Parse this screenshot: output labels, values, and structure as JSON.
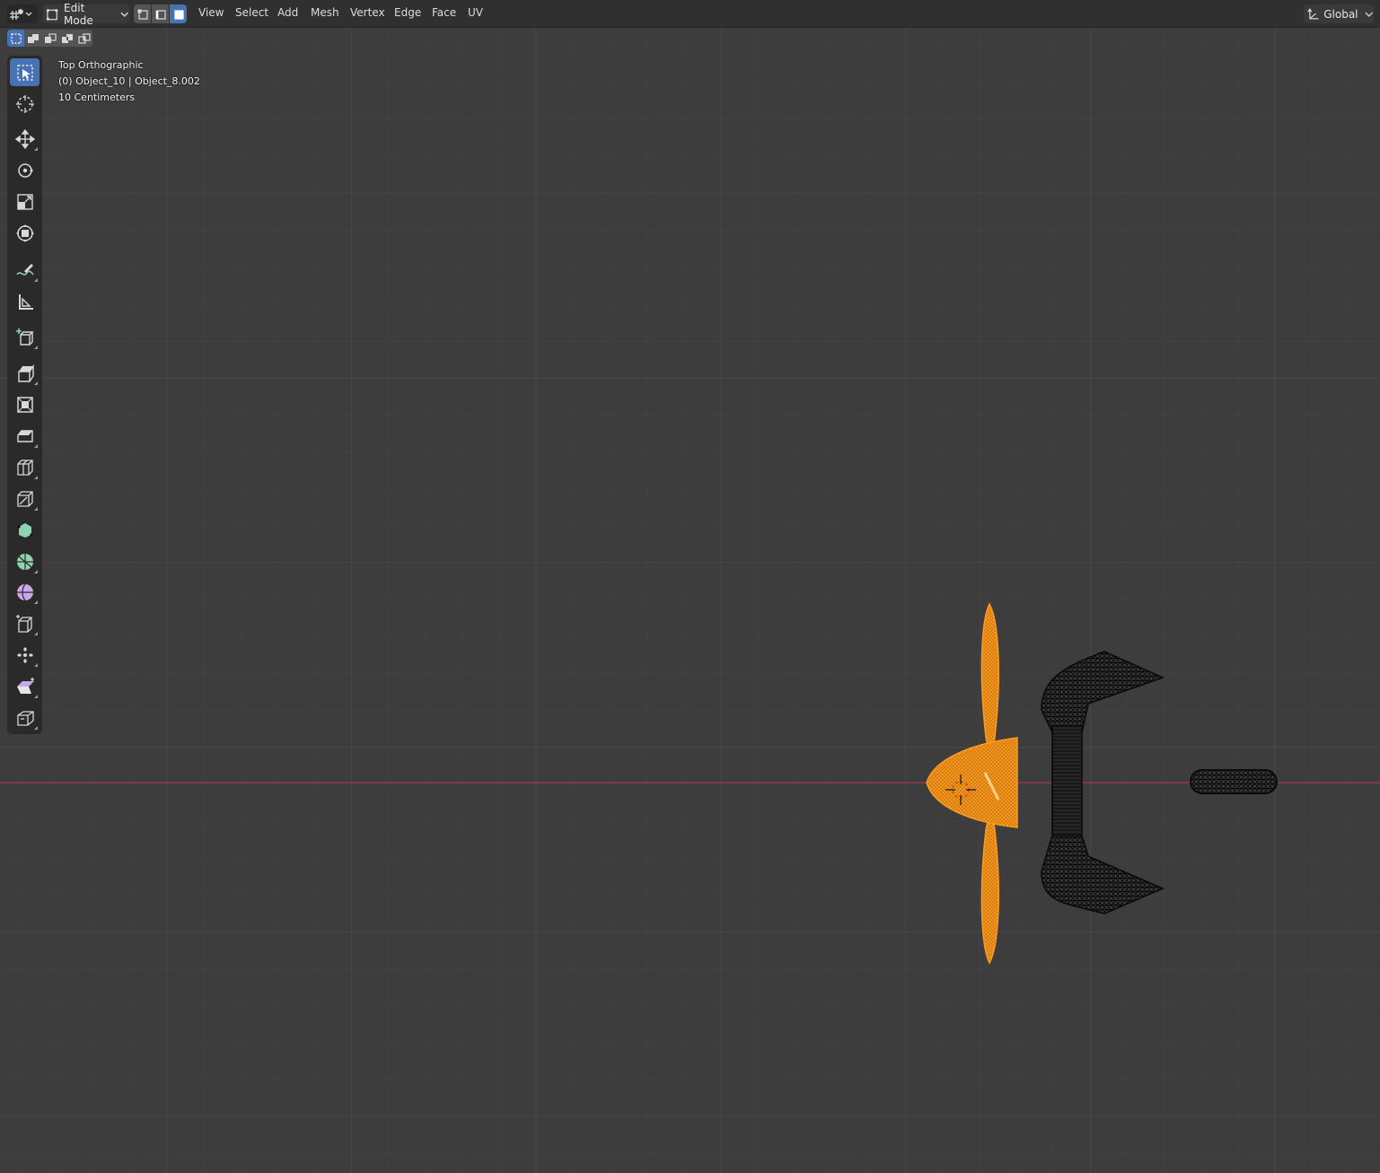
{
  "header": {
    "editor_type_icon": "editor-type-icon",
    "mode_label": "Edit Mode",
    "select_modes": [
      "vertex",
      "edge",
      "face"
    ],
    "active_select_mode": "face",
    "menus": [
      "View",
      "Select",
      "Add",
      "Mesh",
      "Vertex",
      "Edge",
      "Face",
      "UV"
    ],
    "orientation_label": "Global"
  },
  "box_select_modes": [
    "new",
    "extend",
    "subtract",
    "invert",
    "intersect"
  ],
  "viewport": {
    "view_name": "Top Orthographic",
    "object_info": "(0) Object_10 | Object_8.002",
    "grid_scale": "10 Centimeters"
  },
  "tools": [
    {
      "name": "select-box",
      "icon": "select-box-icon",
      "active": true
    },
    {
      "name": "cursor",
      "icon": "cursor-icon"
    },
    {
      "name": "move",
      "icon": "move-icon"
    },
    {
      "name": "rotate",
      "icon": "rotate-icon"
    },
    {
      "name": "scale",
      "icon": "scale-icon"
    },
    {
      "name": "transform",
      "icon": "transform-icon"
    },
    {
      "name": "annotate",
      "icon": "annotate-icon"
    },
    {
      "name": "measure",
      "icon": "measure-icon"
    },
    {
      "name": "add-cube",
      "icon": "add-cube-icon"
    },
    {
      "name": "extrude-region",
      "icon": "extrude-region-icon"
    },
    {
      "name": "inset-faces",
      "icon": "inset-faces-icon"
    },
    {
      "name": "bevel",
      "icon": "bevel-icon"
    },
    {
      "name": "loop-cut",
      "icon": "loop-cut-icon"
    },
    {
      "name": "knife",
      "icon": "knife-icon"
    },
    {
      "name": "poly-build",
      "icon": "poly-build-icon"
    },
    {
      "name": "spin",
      "icon": "spin-icon"
    },
    {
      "name": "smooth",
      "icon": "smooth-icon"
    },
    {
      "name": "edge-slide",
      "icon": "edge-slide-icon"
    },
    {
      "name": "shrink-fatten",
      "icon": "shrink-fatten-icon"
    },
    {
      "name": "shear",
      "icon": "shear-icon"
    },
    {
      "name": "rip-region",
      "icon": "rip-region-icon"
    }
  ],
  "colors": {
    "header_bg": "#303030",
    "viewport_bg": "#3d3d3d",
    "grid_minor": "#454545",
    "grid_major": "#4d4d4d",
    "x_axis": "#8f3a46",
    "active_blue": "#4772b3",
    "selected_mesh": "#ff9a1f",
    "unselected_mesh": "#0a0a0a"
  }
}
